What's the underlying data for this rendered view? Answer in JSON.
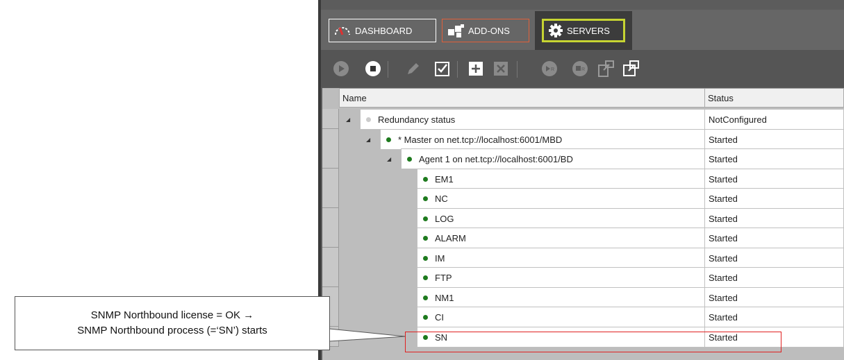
{
  "tabs": {
    "dashboard": "DASHBOARD",
    "addons": "ADD-ONS",
    "servers": "SERVERS"
  },
  "toolbar": {
    "icons": [
      "play-icon",
      "stop-icon",
      "edit-icon",
      "checklist-icon",
      "add-icon",
      "delete-icon",
      "start-redundant-icon",
      "stop-redundant-icon",
      "export-icon",
      "import-icon"
    ]
  },
  "grid": {
    "columns": {
      "name": "Name",
      "status": "Status"
    },
    "rows": [
      {
        "name": "Redundancy status",
        "status": "NotConfigured",
        "level": 0,
        "state": "grey"
      },
      {
        "name": "* Master on net.tcp://localhost:6001/MBD",
        "status": "Started",
        "level": 1,
        "state": "green"
      },
      {
        "name": "Agent 1 on net.tcp://localhost:6001/BD",
        "status": "Started",
        "level": 2,
        "state": "green"
      },
      {
        "name": "EM1",
        "status": "Started",
        "level": 3,
        "state": "green"
      },
      {
        "name": "NC",
        "status": "Started",
        "level": 3,
        "state": "green"
      },
      {
        "name": "LOG",
        "status": "Started",
        "level": 3,
        "state": "green"
      },
      {
        "name": "ALARM",
        "status": "Started",
        "level": 3,
        "state": "green"
      },
      {
        "name": "IM",
        "status": "Started",
        "level": 3,
        "state": "green"
      },
      {
        "name": "FTP",
        "status": "Started",
        "level": 3,
        "state": "green"
      },
      {
        "name": "NM1",
        "status": "Started",
        "level": 3,
        "state": "green"
      },
      {
        "name": "CI",
        "status": "Started",
        "level": 3,
        "state": "green"
      },
      {
        "name": "SN",
        "status": "Started",
        "level": 3,
        "state": "green"
      }
    ]
  },
  "callout": {
    "line1": "SNMP Northbound license = OK →",
    "line2": "SNMP Northbound process (=‘SN’) starts"
  },
  "colors": {
    "servers_highlight": "#c6d432",
    "addons_border": "#e0603a",
    "status_green": "#1e7a1e",
    "highlight_box": "#e02020"
  }
}
